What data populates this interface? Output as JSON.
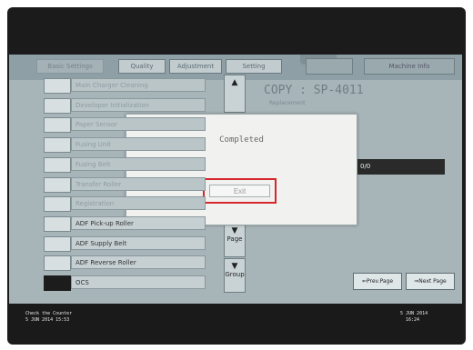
{
  "tabs": [
    "Basic Settings",
    "Quality",
    "Adjustment",
    "Setting",
    "Machine Info"
  ],
  "list_items": [
    {
      "label": "Main Charger Cleaning",
      "dark": false,
      "faint": true
    },
    {
      "label": "Developer Initialization",
      "dark": false,
      "faint": true
    },
    {
      "label": "Paper Sensor",
      "dark": false,
      "faint": true
    },
    {
      "label": "Fusing Unit",
      "dark": false,
      "faint": true
    },
    {
      "label": "Fusing Belt",
      "dark": false,
      "faint": true
    },
    {
      "label": "Transfer Roller",
      "dark": false,
      "faint": true
    },
    {
      "label": "Registration",
      "dark": false,
      "faint": true
    },
    {
      "label": "ADF Pick-up Roller",
      "dark": false,
      "faint": false
    },
    {
      "label": "ADF Supply Belt",
      "dark": false,
      "faint": false
    },
    {
      "label": "ADF Reverse Roller",
      "dark": false,
      "faint": false
    },
    {
      "label": "OCS",
      "dark": true,
      "faint": false
    }
  ],
  "scroll": {
    "page_label": "Page",
    "group_label": "Group"
  },
  "right_panel": {
    "copy_text": "COPY : SP-4011",
    "sub_text": "Replacement",
    "bar_text": "0/0",
    "prev_page": "Prev.Page",
    "next_page": "Next Page"
  },
  "dialog": {
    "title": "Completed",
    "exit_label": "Exit"
  },
  "status": {
    "left_line1": "Check the Counter",
    "left_line2": "5 JUN  2014 15:53",
    "right_date": "5 JUN  2014",
    "right_time": "16:24"
  }
}
